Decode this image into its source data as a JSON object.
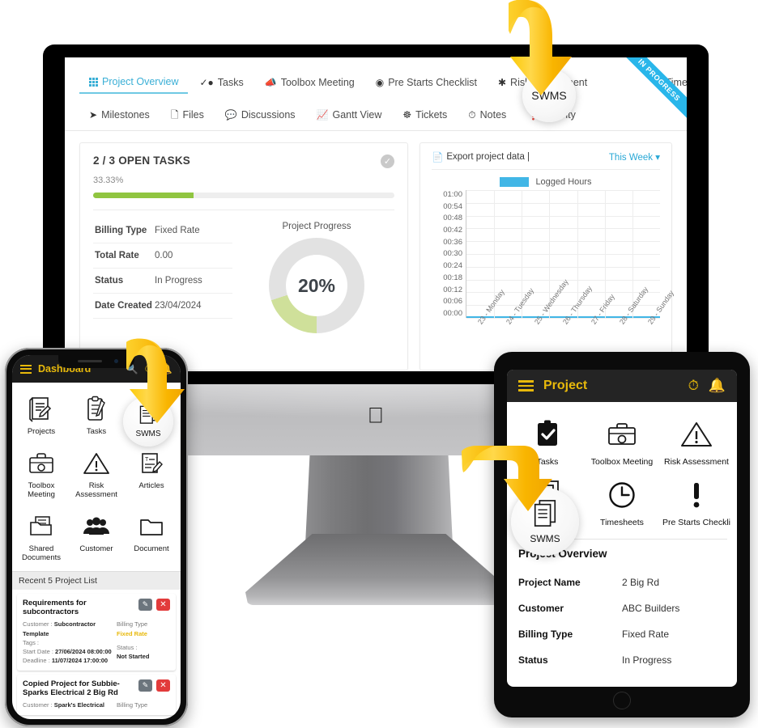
{
  "desktop": {
    "tabs_row1": [
      {
        "label": "Project Overview",
        "icon": "grid-icon",
        "active": true
      },
      {
        "label": "Tasks",
        "icon": "check-circle-icon",
        "active": false
      },
      {
        "label": "Toolbox Meeting",
        "icon": "megaphone-icon",
        "active": false
      },
      {
        "label": "Pre Starts Checklist",
        "icon": "radio-circle-icon",
        "active": false
      },
      {
        "label": "Risk Assessment",
        "icon": "asterisk-icon",
        "active": false
      },
      {
        "label": "Timer Records",
        "icon": "clock-icon",
        "active": false
      }
    ],
    "tabs_row2": [
      {
        "label": "Milestones",
        "icon": "paper-plane-icon"
      },
      {
        "label": "Files",
        "icon": "files-icon"
      },
      {
        "label": "Discussions",
        "icon": "chat-bubble-icon"
      },
      {
        "label": "Gantt View",
        "icon": "chart-line-icon"
      },
      {
        "label": "Tickets",
        "icon": "life-ring-icon"
      },
      {
        "label": "Notes",
        "icon": "clock-icon"
      },
      {
        "label": "Activity",
        "icon": "exclamation-icon"
      }
    ],
    "ribbon": "IN PROGRESS",
    "open_tasks": {
      "title": "2 / 3 OPEN TASKS",
      "percent_label": "33.33%",
      "percent_value": 33.33
    },
    "details": [
      {
        "key": "Billing Type",
        "value": "Fixed Rate"
      },
      {
        "key": "Total Rate",
        "value": "0.00"
      },
      {
        "key": "Status",
        "value": "In Progress"
      },
      {
        "key": "Date Created",
        "value": "23/04/2024"
      }
    ],
    "progress": {
      "title": "Project Progress",
      "label": "20%",
      "value": 20
    },
    "export_label": "Export project data |",
    "week_selector": "This Week",
    "chart_data": {
      "type": "line",
      "title": "",
      "legend": [
        "Logged Hours"
      ],
      "legend_position": "top-center",
      "series": [
        {
          "name": "Logged Hours",
          "values": [
            0,
            0,
            0,
            0,
            0,
            0,
            0
          ],
          "color": "#41b6e6"
        }
      ],
      "categories": [
        "23 - Monday",
        "24 - Tuesday",
        "25 - Wednesday",
        "26 - Thursday",
        "27 - Friday",
        "28 - Saturday",
        "29 - Sunday"
      ],
      "visible_categories": [
        "23 - Monday",
        "24 - Tuesday",
        "25 - Wednesday"
      ],
      "ylabel": "",
      "xlabel": "",
      "yticks": [
        "01:00",
        "00:54",
        "00:48",
        "00:42",
        "00:36",
        "00:30",
        "00:24",
        "00:18",
        "00:12",
        "00:06",
        "00:00"
      ],
      "ylim": [
        "00:00",
        "01:00"
      ],
      "grid": true
    }
  },
  "phone": {
    "header": {
      "title": "Dashboard",
      "menu_icon": "hamburger-icon",
      "search_icon": "search-icon",
      "timer_icon": "stopwatch-icon",
      "bell_icon": "bell-icon"
    },
    "tiles": [
      {
        "label": "Projects",
        "icon": "contract-document-icon"
      },
      {
        "label": "Tasks",
        "icon": "clipboard-checklist-icon"
      },
      {
        "label": "SWMS",
        "icon": "documents-stack-icon"
      },
      {
        "label": "Toolbox Meeting",
        "icon": "toolbox-icon"
      },
      {
        "label": "Risk Assessment",
        "icon": "warning-triangle-icon"
      },
      {
        "label": "Articles",
        "icon": "article-edit-icon"
      },
      {
        "label": "Shared Documents",
        "icon": "shared-folder-icon"
      },
      {
        "label": "Customer",
        "icon": "people-group-icon"
      },
      {
        "label": "Document",
        "icon": "folder-icon"
      }
    ],
    "recent_header": "Recent 5 Project List",
    "projects": [
      {
        "title": "Requirements for subcontractors",
        "customer_key": "Customer :",
        "customer": "Subcontractor Template",
        "tags_key": "Tags        :",
        "tags": "",
        "start_key": "Start Date :",
        "start": "27/06/2024 08:00:00",
        "deadline_key": "Deadline :",
        "deadline": "11/07/2024 17:00:00",
        "billing_key": "Billing Type",
        "billing": "Fixed Rate",
        "status_key": "Status :",
        "status": "Not Started"
      },
      {
        "title": "Copied Project for Subbie-Sparks Electrical 2 Big Rd",
        "customer_key": "Customer :",
        "customer": "Spark's Electrical",
        "billing_key": "Billing Type"
      }
    ]
  },
  "tablet": {
    "header": {
      "title": "Project",
      "menu_icon": "hamburger-icon",
      "timer_icon": "stopwatch-icon",
      "bell_icon": "bell-icon"
    },
    "tiles": [
      {
        "label": "Tasks",
        "icon": "clipboard-check-filled-icon"
      },
      {
        "label": "Toolbox Meeting",
        "icon": "toolbox-icon"
      },
      {
        "label": "Risk Assessment",
        "icon": "warning-triangle-icon"
      },
      {
        "label": "SWMS",
        "icon": "documents-stack-icon"
      },
      {
        "label": "Timesheets",
        "icon": "clock-icon"
      },
      {
        "label": "Pre Starts Checkli",
        "icon": "exclamation-icon"
      }
    ],
    "overview_title": "Project Overview",
    "overview_rows": [
      {
        "key": "Project Name",
        "value": "2 Big Rd"
      },
      {
        "key": "Customer",
        "value": "ABC Builders"
      },
      {
        "key": "Billing Type",
        "value": "Fixed Rate"
      },
      {
        "key": "Status",
        "value": "In Progress"
      }
    ]
  },
  "highlights": [
    {
      "label": "SWMS",
      "target": "desktop"
    },
    {
      "label": "SWMS",
      "target": "phone"
    },
    {
      "label": "SWMS",
      "target": "tablet"
    }
  ],
  "colors": {
    "accent_blue": "#29a8d6",
    "ribbon_blue": "#29b6ea",
    "arrow_yellow": "#f9b800",
    "progress_green": "#90c540",
    "donut_green": "#cfe09a",
    "mobile_gold": "#e8b90b",
    "chart_blue": "#41b6e6"
  }
}
